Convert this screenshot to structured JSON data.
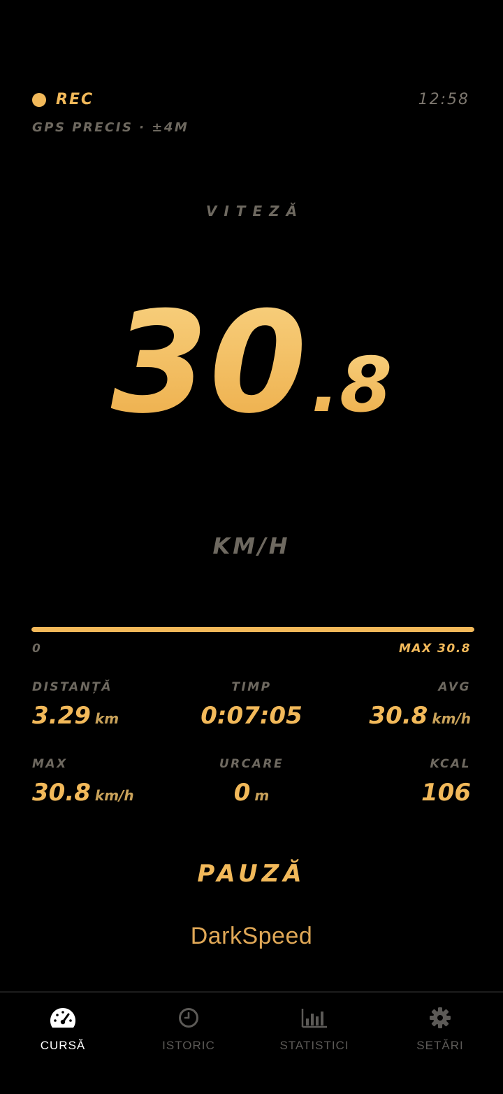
{
  "status": {
    "rec_label": "REC",
    "clock": "12:58",
    "gps_label": "GPS PRECIS · ±4M"
  },
  "speed": {
    "title": "VITEZĂ",
    "integer": "30",
    "decimal": ".8",
    "unit": "KM/H"
  },
  "progress": {
    "min_label": "0",
    "max_label": "MAX 30.8",
    "fraction": 1.0
  },
  "stats": {
    "distance": {
      "label": "DISTANȚĂ",
      "value": "3.29",
      "unit": "km"
    },
    "time": {
      "label": "TIMP",
      "value": "0:07:05"
    },
    "avg": {
      "label": "AVG",
      "value": "30.8",
      "unit": "km/h"
    },
    "max": {
      "label": "MAX",
      "value": "30.8",
      "unit": "km/h"
    },
    "climb": {
      "label": "URCARE",
      "value": "0",
      "unit": "m"
    },
    "kcal": {
      "label": "KCAL",
      "value": "106"
    }
  },
  "pause_label": "PAUZĂ",
  "brand": "DarkSpeed",
  "nav": {
    "items": [
      {
        "label": "CURSĂ",
        "icon": "speedometer-icon",
        "active": true
      },
      {
        "label": "ISTORIC",
        "icon": "clock-icon",
        "active": false
      },
      {
        "label": "STATISTICI",
        "icon": "bar-chart-icon",
        "active": false
      },
      {
        "label": "SETĂRI",
        "icon": "gear-icon",
        "active": false
      }
    ]
  },
  "colors": {
    "accent": "#F2B95A",
    "muted": "#6e6960",
    "background": "#000000",
    "nav_active": "#FFFFFF",
    "nav_inactive": "#5C5A57"
  }
}
